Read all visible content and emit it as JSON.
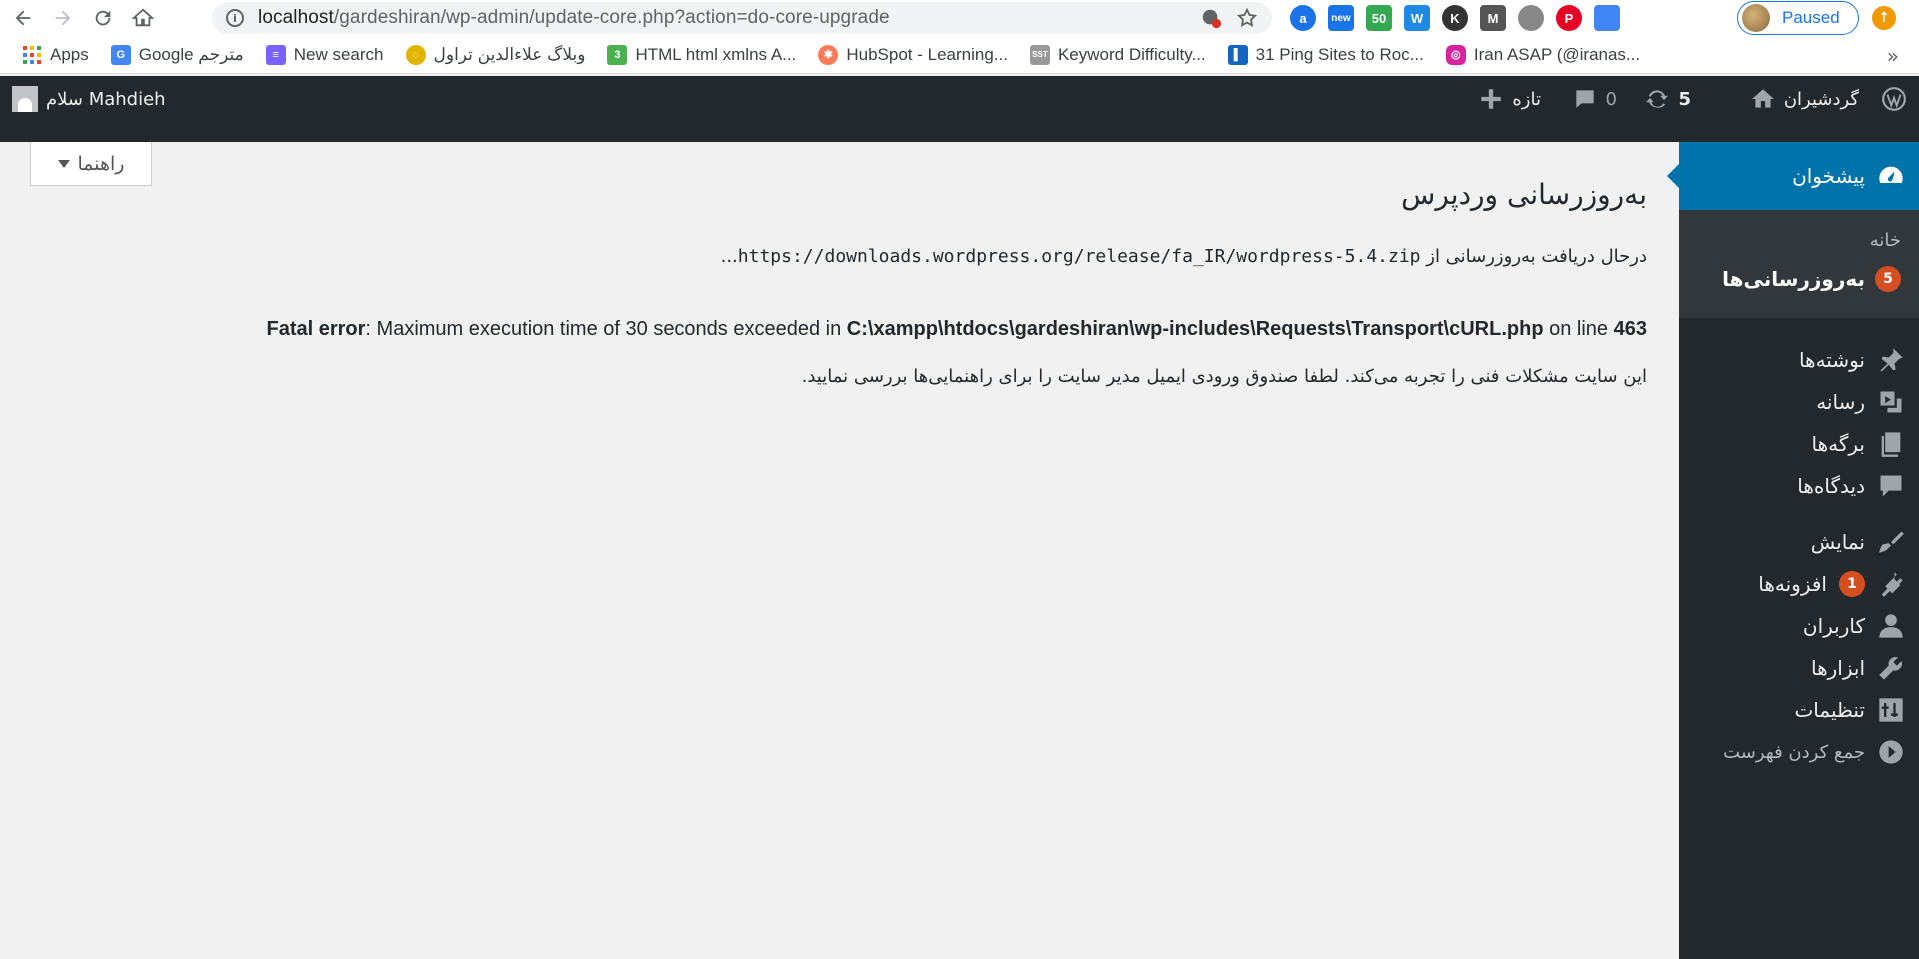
{
  "browser": {
    "url_host": "localhost",
    "url_path": "/gardeshiran/wp-admin/update-core.php?action=do-core-upgrade",
    "profile_status": "Paused",
    "extensions": [
      {
        "label": "a",
        "color": "#1a73e8"
      },
      {
        "label": "new",
        "color": "#1a73e8"
      },
      {
        "label": "50",
        "color": "#34a853"
      },
      {
        "label": "W",
        "color": "#1e88e5"
      },
      {
        "label": "K",
        "color": "#333333"
      },
      {
        "label": "M",
        "color": "#555555"
      },
      {
        "label": "",
        "color": "#888888"
      },
      {
        "label": "P",
        "color": "#e60023"
      },
      {
        "label": "",
        "color": "#4285f4"
      }
    ],
    "bookmarks": [
      {
        "label": "Apps",
        "icon": "apps-grid-icon",
        "color": "#ea4335"
      },
      {
        "label": "Google مترجم",
        "icon": "google-translate-icon",
        "color": "#4285f4"
      },
      {
        "label": "New search",
        "icon": "search-lines-icon",
        "color": "#7b61ff"
      },
      {
        "label": "وبلاگ علاءالدین تراول",
        "icon": "aladdin-icon",
        "color": "#e0b400"
      },
      {
        "label": "HTML html xmlns A...",
        "icon": "w3-icon",
        "color": "#4caf50"
      },
      {
        "label": "HubSpot - Learning...",
        "icon": "hubspot-icon",
        "color": "#ff7a59"
      },
      {
        "label": "Keyword Difficulty...",
        "icon": "sst-icon",
        "color": "#999999"
      },
      {
        "label": "31 Ping Sites to Roc...",
        "icon": "ping-icon",
        "color": "#1565c0"
      },
      {
        "label": "Iran ASAP (@iranas...",
        "icon": "instagram-icon",
        "color": "#d6249f"
      }
    ]
  },
  "adminbar": {
    "site_name": "گردشیران",
    "updates_count": "5",
    "comments_count": "0",
    "new_label": "تازه",
    "greeting": "سلام Mahdieh"
  },
  "sidebar": {
    "dashboard": "پیشخوان",
    "home": "خانه",
    "updates": "به‌روزرسانی‌ها",
    "updates_badge": "5",
    "posts": "نوشته‌ها",
    "media": "رسانه",
    "pages": "برگه‌ها",
    "comments": "دیدگاه‌ها",
    "appearance": "نمایش",
    "plugins": "افزونه‌ها",
    "plugins_badge": "1",
    "users": "کاربران",
    "tools": "ابزارها",
    "settings": "تنظیمات",
    "collapse": "جمع کردن فهرست"
  },
  "content": {
    "help_tab": "راهنما",
    "title": "به‌روزرسانی وردپرس",
    "downloading_prefix": "درحال دریافت به‌روزرسانی از",
    "download_url": "https://downloads.wordpress.org/release/fa_IR/wordpress-5.4.zip",
    "downloading_suffix": "...",
    "fatal_label": "Fatal error",
    "fatal_message": ": Maximum execution time of 30 seconds exceeded in ",
    "fatal_file": "C:\\xampp\\htdocs\\gardeshiran\\wp-includes\\Requests\\Transport\\cURL.php",
    "fatal_online": " on line ",
    "fatal_line": "463",
    "critical_message": "این سایت مشکلات فنی را تجربه می‌کند. لطفا صندوق ورودی ایمیل مدیر سایت را برای راهنمایی‌ها بررسی نمایید."
  }
}
